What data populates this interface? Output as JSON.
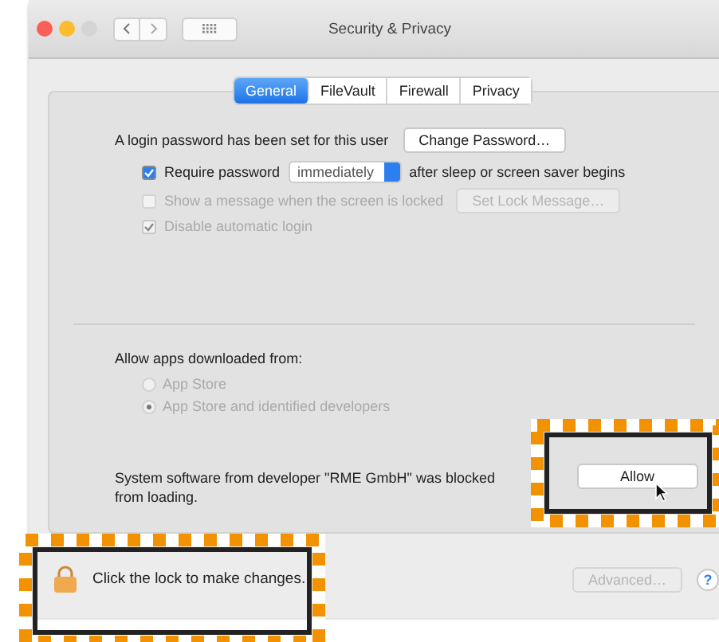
{
  "window": {
    "title": "Security & Privacy"
  },
  "tabs": [
    {
      "label": "General",
      "selected": true
    },
    {
      "label": "FileVault",
      "selected": false
    },
    {
      "label": "Firewall",
      "selected": false
    },
    {
      "label": "Privacy",
      "selected": false
    }
  ],
  "login": {
    "text": "A login password has been set for this user",
    "button": "Change Password…"
  },
  "options": [
    {
      "kind": "select",
      "label": "Require password",
      "checked": true,
      "disabled": false,
      "select": "immediately",
      "suffix": "after sleep or screen saver begins"
    },
    {
      "kind": "button",
      "label": "Show a message when the screen is locked",
      "checked": false,
      "disabled": true,
      "button": "Set Lock Message…"
    },
    {
      "kind": "plain",
      "label": "Disable automatic login",
      "checked": true,
      "disabled": true
    }
  ],
  "downloads": {
    "heading": "Allow apps downloaded from:",
    "options": [
      {
        "label": "App Store",
        "selected": false,
        "disabled": true
      },
      {
        "label": "App Store and identified developers",
        "selected": true,
        "disabled": true
      }
    ]
  },
  "blocked": {
    "message": "System software from developer \"RME GmbH\" was blocked from loading.",
    "button": "Allow"
  },
  "footer": {
    "lock_text": "Click the lock to make changes.",
    "advanced": "Advanced…",
    "advanced_disabled": true,
    "help": "?"
  }
}
